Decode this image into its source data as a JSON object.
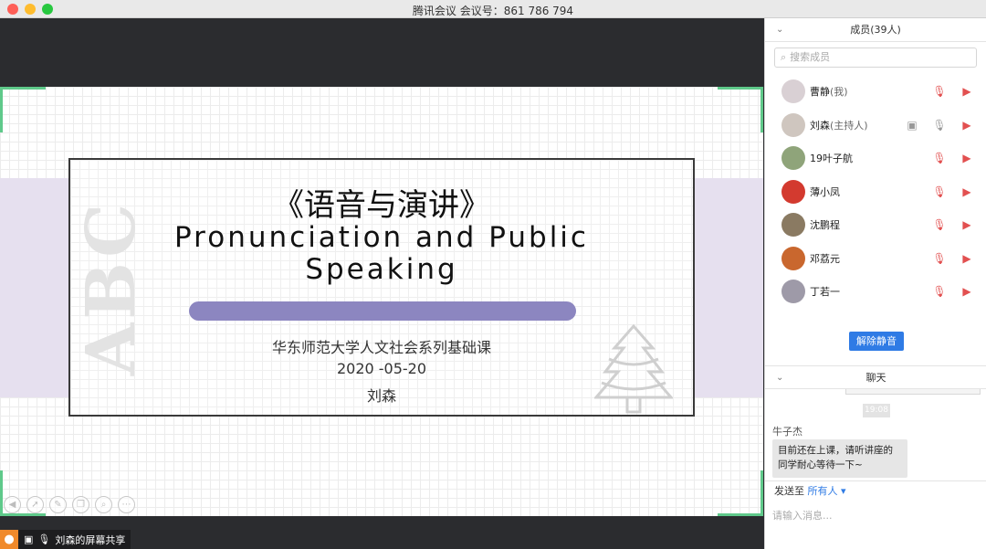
{
  "window": {
    "title": "腾讯会议 会议号：861 786 794"
  },
  "slide": {
    "title_cn": "《语音与演讲》",
    "title_en_line1": "Pronunciation and Public",
    "title_en_line2": "Speaking",
    "watermark": "ABC",
    "subtitle": "华东师范大学人文社会系列基础课",
    "date": "2020 -05-20",
    "author": "刘森"
  },
  "share_bar": {
    "label": "刘森的屏幕共享"
  },
  "members": {
    "header": "成员(39人)",
    "search_placeholder": "搜索成员",
    "list": [
      {
        "name": "曹静",
        "tag": "(我)",
        "avatar_color": "#d9d0d4",
        "muted": true
      },
      {
        "name": "刘森",
        "tag": "(主持人)",
        "avatar_color": "#cfc6bf",
        "muted": false,
        "sharing": true
      },
      {
        "name": "19叶子航",
        "tag": "",
        "avatar_color": "#8fa47a",
        "muted": true
      },
      {
        "name": "薄小凤",
        "tag": "",
        "avatar_color": "#d33a2f",
        "muted": true
      },
      {
        "name": "沈鹏程",
        "tag": "",
        "avatar_color": "#8a7a62",
        "muted": true
      },
      {
        "name": "邓荔元",
        "tag": "",
        "avatar_color": "#c9672e",
        "muted": true
      },
      {
        "name": "丁若一",
        "tag": "",
        "avatar_color": "#9e9aa8",
        "muted": true
      }
    ],
    "unmute_all_label": "解除静音"
  },
  "chat": {
    "header": "聊天",
    "time": "19:08",
    "sender": "牛子杰",
    "message": "目前还在上课，请听讲座的同学耐心等待一下~",
    "send_to_label": "发送至",
    "send_to_target": "所有人",
    "input_placeholder": "请输入消息..."
  },
  "colors": {
    "accent": "#2f7be5",
    "corner": "#5fc98a",
    "slide_bar": "#8c86c0",
    "band": "#e6e0ef"
  }
}
